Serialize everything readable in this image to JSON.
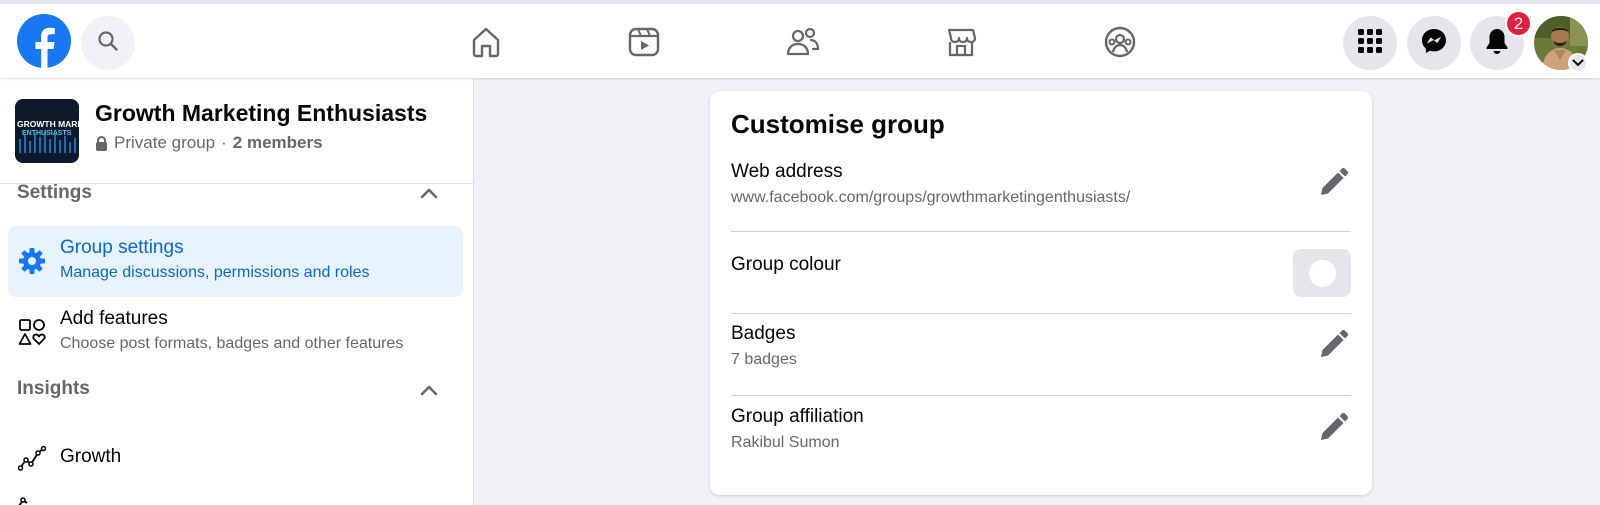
{
  "colors": {
    "brand": "#1877f2",
    "active_text": "#0a66d0",
    "active_bg": "#e7f3ff",
    "badge": "#e41e3f",
    "secondary_text": "#65676b"
  },
  "topbar": {
    "logo_icon": "facebook-logo",
    "search_icon": "search-icon",
    "nav_icons": [
      "home-icon",
      "video-icon",
      "friends-icon",
      "marketplace-icon",
      "groups-icon"
    ],
    "right_icons": [
      "menu-grid-icon",
      "messenger-icon",
      "notifications-icon"
    ],
    "notifications_count": "2"
  },
  "sidebar": {
    "group": {
      "name": "Growth Marketing Enthusiasts",
      "privacy": "Private group",
      "separator": "·",
      "members": "2 members",
      "thumbnail_lines": [
        "GROWTH MARKETI",
        "ENTHUSIASTS"
      ]
    },
    "sections": [
      {
        "title": "Settings",
        "items": [
          {
            "title": "Group settings",
            "subtitle": "Manage discussions, permissions and roles",
            "icon": "gear-icon",
            "active": true
          },
          {
            "title": "Add features",
            "subtitle": "Choose post formats, badges and other features",
            "icon": "shapes-icon",
            "active": false
          }
        ]
      },
      {
        "title": "Insights",
        "items": [
          {
            "title": "Growth",
            "subtitle": "",
            "icon": "trend-icon",
            "active": false
          }
        ]
      }
    ]
  },
  "card": {
    "title": "Customise group",
    "rows": [
      {
        "label": "Web address",
        "value": "www.facebook.com/groups/growthmarketingenthusiasts/",
        "action_icon": "pencil-icon"
      },
      {
        "label": "Group colour",
        "value": "",
        "action_icon": "colour-swatch-icon"
      },
      {
        "label": "Badges",
        "value": "7 badges",
        "action_icon": "pencil-icon"
      },
      {
        "label": "Group affiliation",
        "value": "Rakibul Sumon",
        "action_icon": "pencil-icon"
      }
    ]
  }
}
